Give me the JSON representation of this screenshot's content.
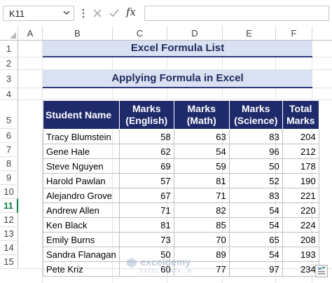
{
  "formula_bar": {
    "name_box": "K11",
    "fx_label": "fx",
    "formula": ""
  },
  "columns": [
    "A",
    "B",
    "C",
    "D",
    "E",
    "F"
  ],
  "rows": [
    "1",
    "2",
    "3",
    "4",
    "5",
    "6",
    "7",
    "8",
    "9",
    "10",
    "11",
    "12",
    "13",
    "14",
    "15"
  ],
  "active_row": "11",
  "sheet": {
    "title": "Excel Formula List",
    "subtitle": "Applying Formula in Excel",
    "headers": [
      [
        "Student Name"
      ],
      [
        "Marks",
        "(English)"
      ],
      [
        "Marks",
        "(Math)"
      ],
      [
        "Marks",
        "(Science)"
      ],
      [
        "Total",
        "Marks"
      ]
    ],
    "students": [
      {
        "name": "Tracy Blumstein",
        "english": "58",
        "math": "63",
        "science": "83",
        "total": "204"
      },
      {
        "name": "Gene Hale",
        "english": "62",
        "math": "54",
        "science": "96",
        "total": "212"
      },
      {
        "name": "Steve Nguyen",
        "english": "69",
        "math": "59",
        "science": "50",
        "total": "178"
      },
      {
        "name": "Harold Pawlan",
        "english": "57",
        "math": "81",
        "science": "52",
        "total": "190"
      },
      {
        "name": "Alejandro Grove",
        "english": "67",
        "math": "71",
        "science": "83",
        "total": "221"
      },
      {
        "name": "Andrew Allen",
        "english": "71",
        "math": "82",
        "science": "54",
        "total": "220"
      },
      {
        "name": "Ken Black",
        "english": "81",
        "math": "85",
        "science": "54",
        "total": "224"
      },
      {
        "name": "Emily Burns",
        "english": "73",
        "math": "70",
        "science": "65",
        "total": "208"
      },
      {
        "name": "Sandra Flanagan",
        "english": "50",
        "math": "89",
        "science": "54",
        "total": "193"
      },
      {
        "name": "Pete Kriz",
        "english": "60",
        "math": "77",
        "science": "97",
        "total": "234"
      }
    ]
  },
  "watermark": {
    "name": "exceldemy",
    "tagline": "EXCEL · DATA · BI"
  },
  "colors": {
    "header_fill": "#1f2a6b",
    "title_fill": "#d9e1f2",
    "active_accent": "#107c41"
  }
}
